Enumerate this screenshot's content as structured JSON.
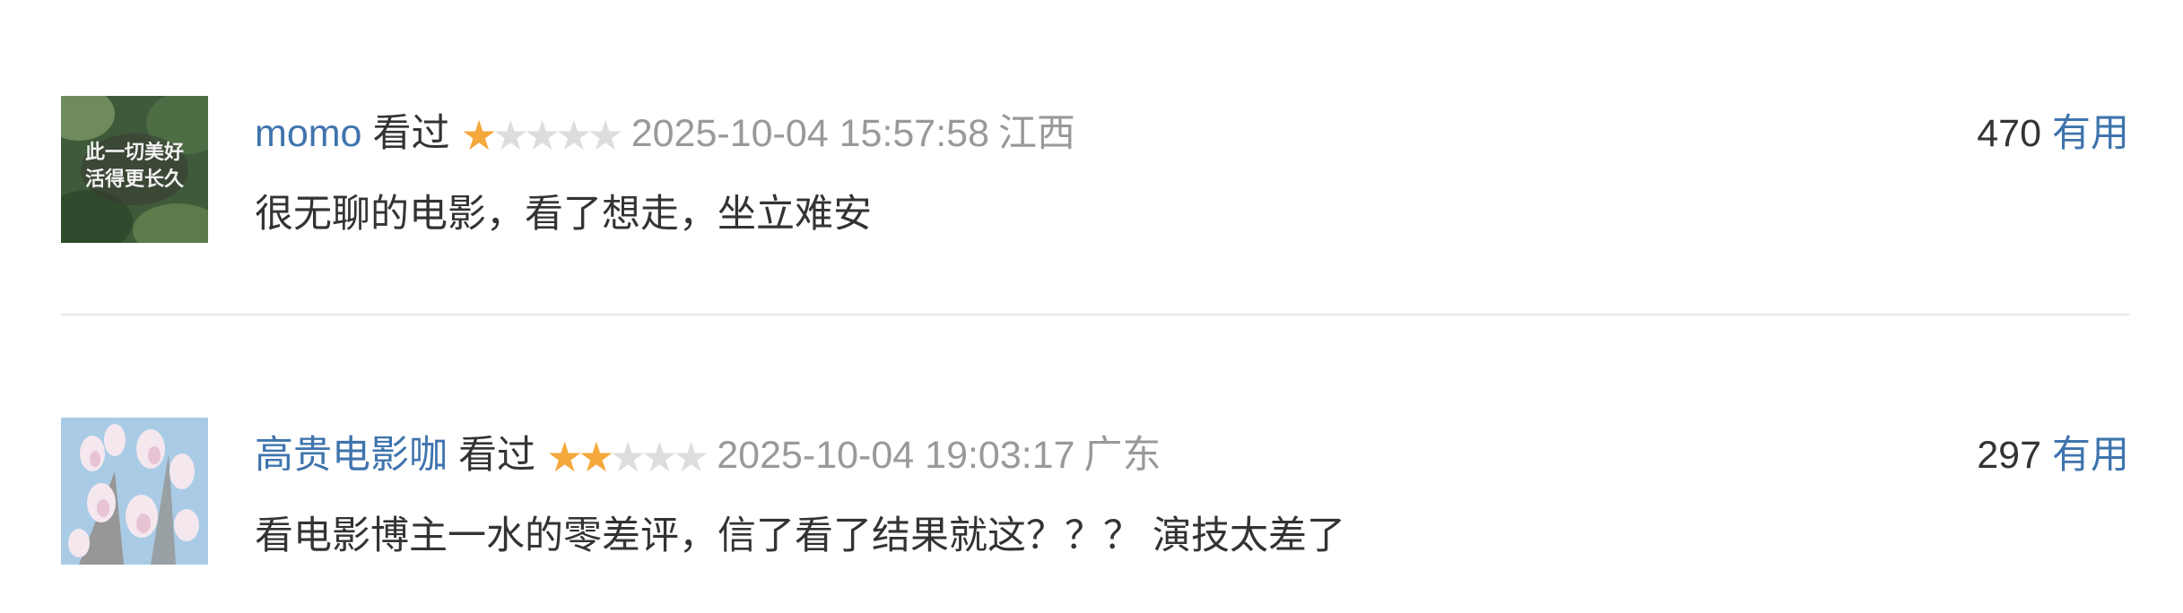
{
  "reviews": [
    {
      "user": "momo",
      "status": "看过",
      "rating": 1,
      "rating_max": 5,
      "time": "2025-10-04 15:57:58",
      "location": "江西",
      "votes": "470",
      "vote_label": "有用",
      "comment": "很无聊的电影，看了想走，坐立难安",
      "avatar_text": [
        "此一切美好",
        "活得更长久"
      ]
    },
    {
      "user": "高贵电影咖",
      "status": "看过",
      "rating": 2,
      "rating_max": 5,
      "time": "2025-10-04 19:03:17",
      "location": "广东",
      "votes": "297",
      "vote_label": "有用",
      "comment": "看电影博主一水的零差评，信了看了结果就这？？？ 演技太差了"
    }
  ],
  "colors": {
    "link": "#3f74ad",
    "star_on": "#f5a83b",
    "star_off": "#dddddd",
    "muted": "#999999",
    "text": "#333333"
  }
}
